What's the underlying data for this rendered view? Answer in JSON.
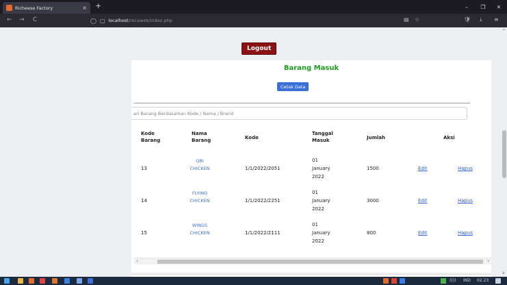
{
  "browser": {
    "tab_title": "Richeese Factory",
    "tab_close": "×",
    "new_tab": "+",
    "url_host": "localhost",
    "url_path": "/recaweb/index.php",
    "win_min": "–",
    "win_max": "❐",
    "win_close": "✕",
    "back": "←",
    "forward": "→",
    "reload": "C",
    "star": "☆",
    "reader": "▤",
    "shield": "🛡",
    "download": "⤓",
    "menu": "≡",
    "lock": "◯",
    "page": "▢"
  },
  "page": {
    "logout_label": "Logout",
    "title": "Barang Masuk",
    "cetak_label": "Cetak Data",
    "search_placeholder": "ari Barang Berdasarkan Kode / Nama / Brand"
  },
  "table": {
    "headers": {
      "kode_barang_1": "Kode",
      "kode_barang_2": "Barang",
      "nama_barang_1": "Nama",
      "nama_barang_2": "Barang",
      "kode": "Kode",
      "tanggal_1": "Tanggal",
      "tanggal_2": "Masuk",
      "jumlah": "Jumlah",
      "aksi": "Aksi"
    },
    "rows": [
      {
        "kode_barang": "13",
        "nama_1": "ORI",
        "nama_2": "CHICKEN",
        "kode": "1/1/2022/2051",
        "tgl_1": "01",
        "tgl_2": "January",
        "tgl_3": "2022",
        "jumlah": "1500",
        "edit": "Edit",
        "hapus": "Hapus"
      },
      {
        "kode_barang": "14",
        "nama_1": "FLYING",
        "nama_2": "CHICKEN",
        "kode": "1/1/2022/2251",
        "tgl_1": "01",
        "tgl_2": "January",
        "tgl_3": "2022",
        "jumlah": "3000",
        "edit": "Edit",
        "hapus": "Hapus"
      },
      {
        "kode_barang": "15",
        "nama_1": "WINGS",
        "nama_2": "CHICKEN",
        "kode": "1/1/2022/2111",
        "tgl_1": "01",
        "tgl_2": "January",
        "tgl_3": "2022",
        "jumlah": "800",
        "edit": "Edit",
        "hapus": "Hapus"
      }
    ]
  },
  "scroll": {
    "left_arrow": "‹",
    "right_arrow": "›",
    "up_arrow": "^",
    "down_arrow": "v"
  },
  "taskbar": {
    "lang": "IND",
    "time": "02.23",
    "volume": "(())"
  },
  "colors": {
    "logout_bg": "#8b1212",
    "title_green": "#1f9a1f",
    "button_blue": "#3a6fd8",
    "link_blue": "#2d5fcf"
  }
}
